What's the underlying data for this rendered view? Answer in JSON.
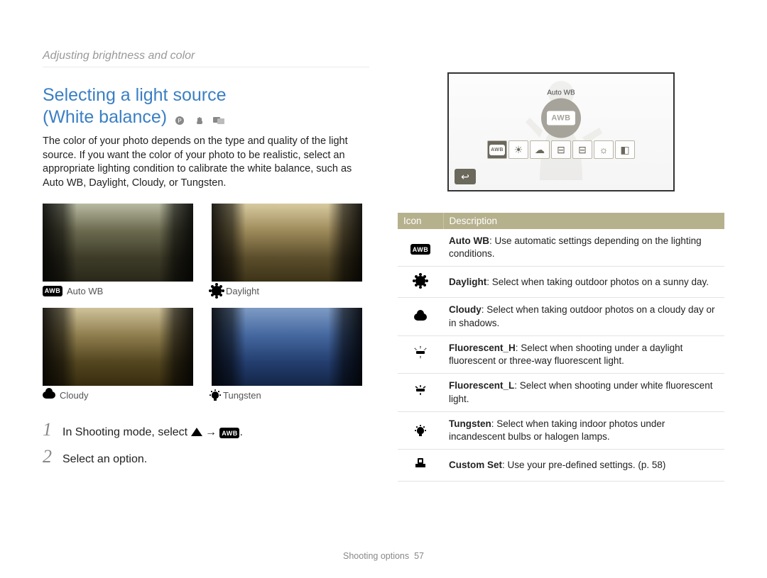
{
  "breadcrumb": "Adjusting brightness and color",
  "heading_line1": "Selecting a light source",
  "heading_line2": "(White balance)",
  "intro": "The color of your photo depends on the type and quality of the light source. If you want the color of your photo to be realistic, select an appropriate lighting condition to calibrate the white balance, such as Auto WB, Daylight, Cloudy, or Tungsten.",
  "thumbs": [
    {
      "label": "Auto WB",
      "icon": "awb"
    },
    {
      "label": "Daylight",
      "icon": "sun"
    },
    {
      "label": "Cloudy",
      "icon": "cloud"
    },
    {
      "label": "Tungsten",
      "icon": "bulb"
    }
  ],
  "steps": {
    "s1_prefix": "In Shooting mode, select ",
    "s1_arrow": " → ",
    "s1_target_label": "AWB",
    "s2": "Select an option."
  },
  "camera": {
    "bubble_label": "Auto WB",
    "bubble_icon_text": "AWB",
    "strip": [
      {
        "icon": "awb",
        "selected": true
      },
      {
        "icon": "sun",
        "selected": false
      },
      {
        "icon": "cloud",
        "selected": false
      },
      {
        "icon": "fluoh",
        "selected": false
      },
      {
        "icon": "fluol",
        "selected": false
      },
      {
        "icon": "bulb",
        "selected": false
      },
      {
        "icon": "custom",
        "selected": false
      }
    ]
  },
  "table": {
    "headers": {
      "icon": "Icon",
      "desc": "Description"
    },
    "rows": [
      {
        "icon": "awb",
        "term": "Auto WB",
        "desc": ": Use automatic settings depending on the lighting conditions."
      },
      {
        "icon": "sun",
        "term": "Daylight",
        "desc": ": Select when taking outdoor photos on a sunny day."
      },
      {
        "icon": "cloud",
        "term": "Cloudy",
        "desc": ": Select when taking outdoor photos on a cloudy day or in shadows."
      },
      {
        "icon": "fluoh",
        "term": "Fluorescent_H",
        "desc": ": Select when shooting under a daylight fluorescent or three-way fluorescent light."
      },
      {
        "icon": "fluol",
        "term": "Fluorescent_L",
        "desc": ": Select when shooting under white fluorescent light."
      },
      {
        "icon": "bulb",
        "term": "Tungsten",
        "desc": ": Select when taking indoor photos under incandescent bulbs or halogen lamps."
      },
      {
        "icon": "custom",
        "term": "Custom Set",
        "desc": ": Use your pre-defined settings. (p. 58)"
      }
    ]
  },
  "footer": {
    "section": "Shooting options",
    "page": "57"
  }
}
